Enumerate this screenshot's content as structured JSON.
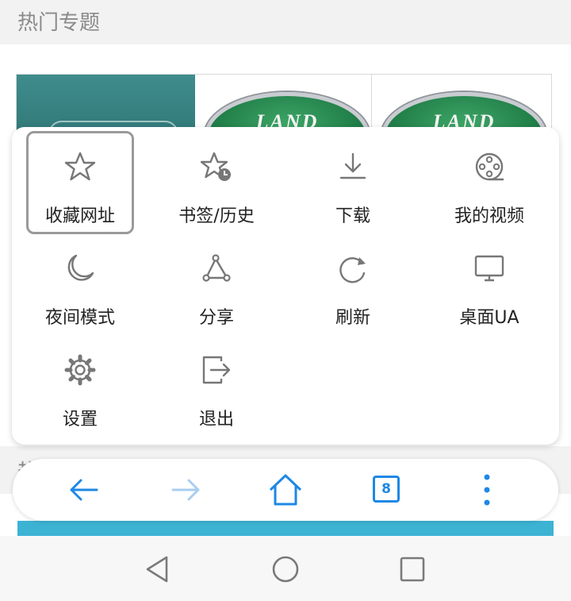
{
  "page": {
    "section_title": "热门专题",
    "section2_title": "热门活动",
    "logo_text": "LAND"
  },
  "menu": {
    "items": [
      {
        "label": "收藏网址",
        "icon": "star-icon",
        "selected": true
      },
      {
        "label": "书签/历史",
        "icon": "bookmark-history-icon"
      },
      {
        "label": "下载",
        "icon": "download-icon"
      },
      {
        "label": "我的视频",
        "icon": "film-reel-icon"
      },
      {
        "label": "夜间模式",
        "icon": "moon-icon"
      },
      {
        "label": "分享",
        "icon": "share-icon"
      },
      {
        "label": "刷新",
        "icon": "refresh-icon"
      },
      {
        "label": "桌面UA",
        "icon": "monitor-icon"
      },
      {
        "label": "设置",
        "icon": "gear-icon"
      },
      {
        "label": "退出",
        "icon": "exit-icon"
      }
    ]
  },
  "toolbar": {
    "tab_count": "8",
    "accent": "#1e88e5",
    "disabled": "#a9cdf2"
  }
}
